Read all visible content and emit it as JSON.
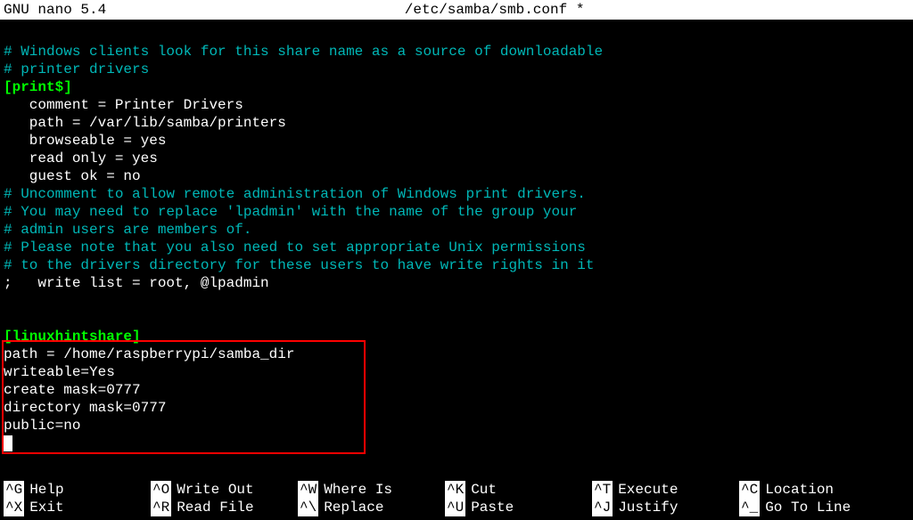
{
  "title_bar": {
    "app": "  GNU nano 5.4",
    "file": "/etc/samba/smb.conf *"
  },
  "lines": [
    {
      "type": "blank",
      "text": ""
    },
    {
      "type": "comment",
      "text": "# Windows clients look for this share name as a source of downloadable"
    },
    {
      "type": "comment",
      "text": "# printer drivers"
    },
    {
      "type": "section",
      "text": "[print$]"
    },
    {
      "type": "normal",
      "text": "   comment = Printer Drivers"
    },
    {
      "type": "normal",
      "text": "   path = /var/lib/samba/printers"
    },
    {
      "type": "normal",
      "text": "   browseable = yes"
    },
    {
      "type": "normal",
      "text": "   read only = yes"
    },
    {
      "type": "normal",
      "text": "   guest ok = no"
    },
    {
      "type": "comment",
      "text": "# Uncomment to allow remote administration of Windows print drivers."
    },
    {
      "type": "comment",
      "text": "# You may need to replace 'lpadmin' with the name of the group your"
    },
    {
      "type": "comment",
      "text": "# admin users are members of."
    },
    {
      "type": "comment",
      "text": "# Please note that you also need to set appropriate Unix permissions"
    },
    {
      "type": "comment",
      "text": "# to the drivers directory for these users to have write rights in it"
    },
    {
      "type": "normal",
      "text": ";   write list = root, @lpadmin"
    },
    {
      "type": "blank",
      "text": ""
    },
    {
      "type": "blank",
      "text": ""
    },
    {
      "type": "section",
      "text": "[linuxhintshare]"
    },
    {
      "type": "normal",
      "text": "path = /home/raspberrypi/samba_dir"
    },
    {
      "type": "normal",
      "text": "writeable=Yes"
    },
    {
      "type": "normal",
      "text": "create mask=0777"
    },
    {
      "type": "normal",
      "text": "directory mask=0777"
    },
    {
      "type": "normal",
      "text": "public=no"
    }
  ],
  "shortcuts": {
    "row1": [
      {
        "key": "^G",
        "label": "Help"
      },
      {
        "key": "^O",
        "label": "Write Out"
      },
      {
        "key": "^W",
        "label": "Where Is"
      },
      {
        "key": "^K",
        "label": "Cut"
      },
      {
        "key": "^T",
        "label": "Execute"
      },
      {
        "key": "^C",
        "label": "Location"
      }
    ],
    "row2": [
      {
        "key": "^X",
        "label": "Exit"
      },
      {
        "key": "^R",
        "label": "Read File"
      },
      {
        "key": "^\\",
        "label": "Replace"
      },
      {
        "key": "^U",
        "label": "Paste"
      },
      {
        "key": "^J",
        "label": "Justify"
      },
      {
        "key": "^_",
        "label": "Go To Line"
      }
    ]
  }
}
